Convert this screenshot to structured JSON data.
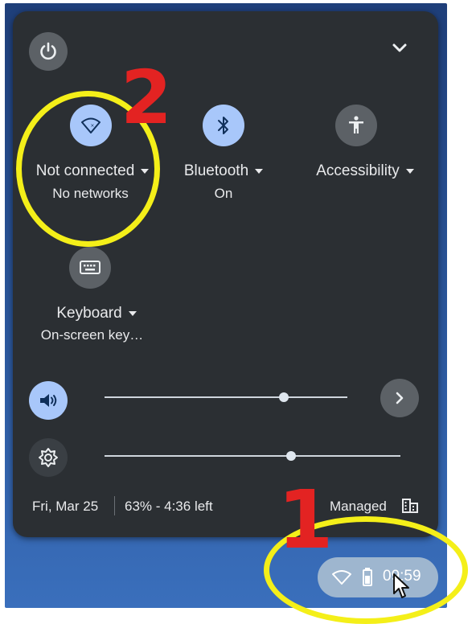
{
  "quick_settings": {
    "network": {
      "label": "Not connected",
      "status": "No networks",
      "icon": "wifi-icon"
    },
    "bluetooth": {
      "label": "Bluetooth",
      "status": "On",
      "icon": "bluetooth-icon"
    },
    "accessibility": {
      "label": "Accessibility",
      "icon": "accessibility-icon"
    },
    "keyboard": {
      "label": "Keyboard",
      "status": "On-screen key…",
      "icon": "keyboard-icon"
    },
    "volume_level": 0.74,
    "brightness_level": 0.63
  },
  "status_bar": {
    "date": "Fri, Mar 25",
    "battery": "63% - 4:36 left",
    "managed": "Managed"
  },
  "shelf": {
    "time": "09:59"
  },
  "annotations": {
    "one": "1",
    "two": "2"
  },
  "colors": {
    "panel_bg": "#2b2f33",
    "active_tile": "#a8c7fa",
    "inactive_tile": "#5c6166",
    "annotation_yellow": "#f4ef19",
    "annotation_red": "#e32322"
  }
}
